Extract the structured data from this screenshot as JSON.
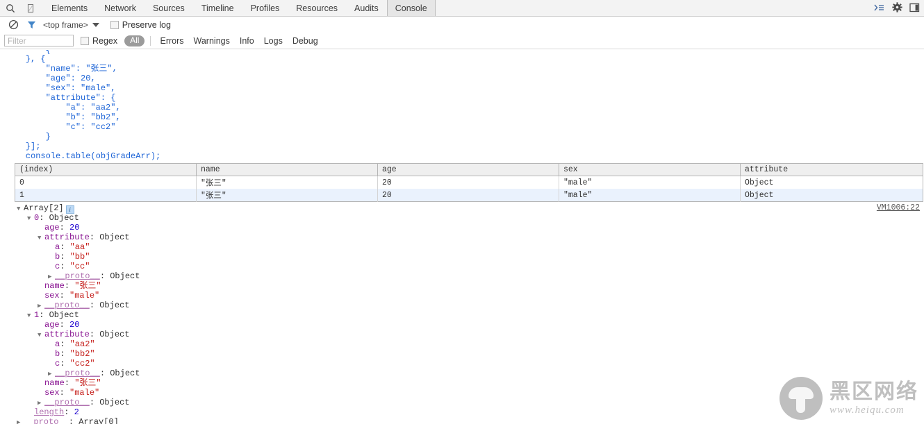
{
  "tabbar": {
    "left_icons": [
      {
        "name": "search-icon",
        "glyph": "⌕"
      },
      {
        "name": "device-toolbar-icon",
        "glyph": "▯"
      }
    ],
    "tabs": [
      {
        "label": "Elements",
        "selected": false
      },
      {
        "label": "Network",
        "selected": false
      },
      {
        "label": "Sources",
        "selected": false
      },
      {
        "label": "Timeline",
        "selected": false
      },
      {
        "label": "Profiles",
        "selected": false
      },
      {
        "label": "Resources",
        "selected": false
      },
      {
        "label": "Audits",
        "selected": false
      },
      {
        "label": "Console",
        "selected": true
      }
    ],
    "right_icons": [
      {
        "name": "console-drawer-icon",
        "glyph": "≫≡"
      },
      {
        "name": "settings-gear-icon",
        "glyph": "⚙"
      },
      {
        "name": "dock-side-icon",
        "glyph": "❐"
      }
    ]
  },
  "toolbar": {
    "clear_console_icon": "clear-console-icon",
    "filter_icon": "filter-funnel-icon",
    "frame_selector_value": "<top frame>",
    "preserve_log_label": "Preserve log",
    "preserve_log_checked": false
  },
  "filter_bar": {
    "filter_placeholder": "Filter",
    "filter_value": "",
    "regex_label": "Regex",
    "regex_checked": false,
    "levels": [
      {
        "label": "All",
        "active": true
      },
      {
        "label": "Errors",
        "active": false
      },
      {
        "label": "Warnings",
        "active": false
      },
      {
        "label": "Info",
        "active": false
      },
      {
        "label": "Logs",
        "active": false
      },
      {
        "label": "Debug",
        "active": false
      }
    ]
  },
  "code": {
    "lines": [
      "        }",
      "    }, {",
      "        \"name\": \"张三\",",
      "        \"age\": 20,",
      "        \"sex\": \"male\",",
      "        \"attribute\": {",
      "            \"a\": \"aa2\",",
      "            \"b\": \"bb2\",",
      "            \"c\": \"cc2\"",
      "        }",
      "    }];",
      "    console.table(objGradeArr);"
    ]
  },
  "console_table": {
    "columns": [
      "(index)",
      "name",
      "age",
      "sex",
      "attribute"
    ],
    "rows": [
      {
        "index": "0",
        "name": "\"张三\"",
        "age": "20",
        "sex": "\"male\"",
        "attribute": "Object"
      },
      {
        "index": "1",
        "name": "\"张三\"",
        "age": "20",
        "sex": "\"male\"",
        "attribute": "Object"
      }
    ]
  },
  "object_tree": {
    "source_link": "VM1006:22",
    "info_badge": "i",
    "nodes": [
      {
        "depth": 0,
        "arrow": "▼",
        "key": "Array[2]",
        "keyclass": "plain",
        "sep": "",
        "value": "",
        "valclass": "plain",
        "badge": true
      },
      {
        "depth": 1,
        "arrow": "▼",
        "key": "0",
        "keyclass": "propname",
        "sep": ": ",
        "value": "Object",
        "valclass": "plain"
      },
      {
        "depth": 2,
        "arrow": "",
        "key": "age",
        "keyclass": "propname",
        "sep": ": ",
        "value": "20",
        "valclass": "num"
      },
      {
        "depth": 2,
        "arrow": "▼",
        "key": "attribute",
        "keyclass": "propname",
        "sep": ": ",
        "value": "Object",
        "valclass": "plain"
      },
      {
        "depth": 3,
        "arrow": "",
        "key": "a",
        "keyclass": "propname",
        "sep": ": ",
        "value": "\"aa\"",
        "valclass": "str"
      },
      {
        "depth": 3,
        "arrow": "",
        "key": "b",
        "keyclass": "propname",
        "sep": ": ",
        "value": "\"bb\"",
        "valclass": "str"
      },
      {
        "depth": 3,
        "arrow": "",
        "key": "c",
        "keyclass": "propname",
        "sep": ": ",
        "value": "\"cc\"",
        "valclass": "str"
      },
      {
        "depth": 3,
        "arrow": "▶",
        "key": "__proto__",
        "keyclass": "protoname",
        "sep": ": ",
        "value": "Object",
        "valclass": "plain"
      },
      {
        "depth": 2,
        "arrow": "",
        "key": "name",
        "keyclass": "propname",
        "sep": ": ",
        "value": "\"张三\"",
        "valclass": "str"
      },
      {
        "depth": 2,
        "arrow": "",
        "key": "sex",
        "keyclass": "propname",
        "sep": ": ",
        "value": "\"male\"",
        "valclass": "str"
      },
      {
        "depth": 2,
        "arrow": "▶",
        "key": "__proto__",
        "keyclass": "protoname",
        "sep": ": ",
        "value": "Object",
        "valclass": "plain"
      },
      {
        "depth": 1,
        "arrow": "▼",
        "key": "1",
        "keyclass": "propname",
        "sep": ": ",
        "value": "Object",
        "valclass": "plain"
      },
      {
        "depth": 2,
        "arrow": "",
        "key": "age",
        "keyclass": "propname",
        "sep": ": ",
        "value": "20",
        "valclass": "num"
      },
      {
        "depth": 2,
        "arrow": "▼",
        "key": "attribute",
        "keyclass": "propname",
        "sep": ": ",
        "value": "Object",
        "valclass": "plain"
      },
      {
        "depth": 3,
        "arrow": "",
        "key": "a",
        "keyclass": "propname",
        "sep": ": ",
        "value": "\"aa2\"",
        "valclass": "str"
      },
      {
        "depth": 3,
        "arrow": "",
        "key": "b",
        "keyclass": "propname",
        "sep": ": ",
        "value": "\"bb2\"",
        "valclass": "str"
      },
      {
        "depth": 3,
        "arrow": "",
        "key": "c",
        "keyclass": "propname",
        "sep": ": ",
        "value": "\"cc2\"",
        "valclass": "str"
      },
      {
        "depth": 3,
        "arrow": "▶",
        "key": "__proto__",
        "keyclass": "protoname",
        "sep": ": ",
        "value": "Object",
        "valclass": "plain"
      },
      {
        "depth": 2,
        "arrow": "",
        "key": "name",
        "keyclass": "propname",
        "sep": ": ",
        "value": "\"张三\"",
        "valclass": "str"
      },
      {
        "depth": 2,
        "arrow": "",
        "key": "sex",
        "keyclass": "propname",
        "sep": ": ",
        "value": "\"male\"",
        "valclass": "str"
      },
      {
        "depth": 2,
        "arrow": "▶",
        "key": "__proto__",
        "keyclass": "protoname",
        "sep": ": ",
        "value": "Object",
        "valclass": "plain"
      },
      {
        "depth": 1,
        "arrow": "",
        "key": "length",
        "keyclass": "protoname",
        "sep": ": ",
        "value": "2",
        "valclass": "num"
      },
      {
        "depth": 0,
        "arrow": "▶",
        "key": "__proto__",
        "keyclass": "protoname",
        "sep": ": ",
        "value": "Array[0]",
        "valclass": "plain"
      }
    ]
  },
  "watermark": {
    "cn_text": "黑区网络",
    "url_text": "www.heiqu.com"
  },
  "colors": {
    "string": "#c41a16",
    "number": "#1c00cf",
    "property": "#881391",
    "code": "#1a62d6",
    "selected_tab_bg": "#e6e6e6",
    "table_row_alt": "#eaf2fd"
  }
}
